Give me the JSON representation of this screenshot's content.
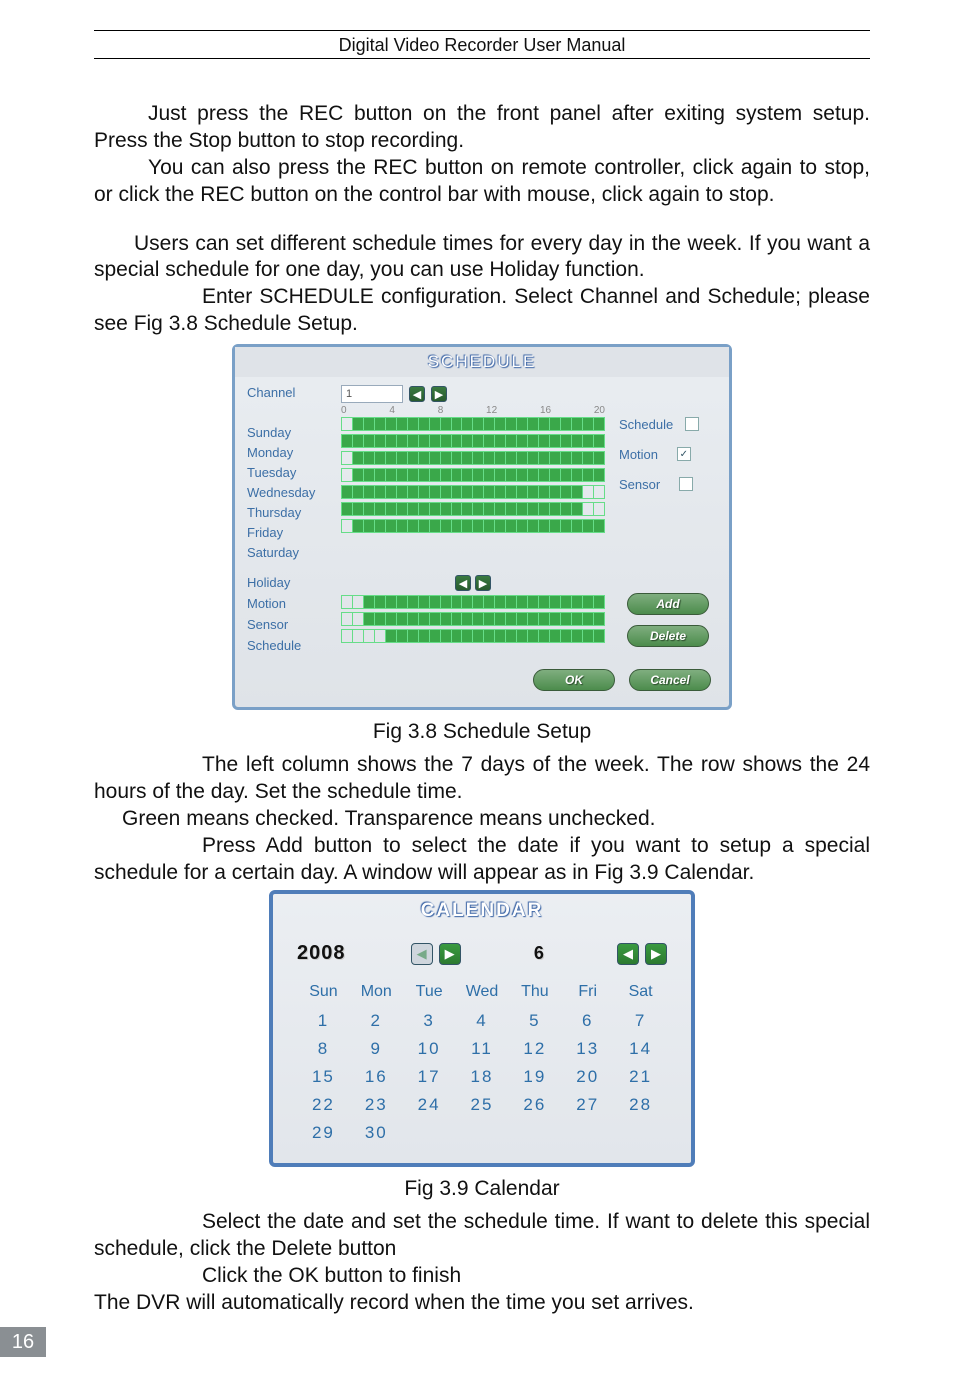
{
  "header": {
    "title": "Digital Video Recorder User Manual"
  },
  "paragraphs": {
    "p1": "Just press the REC button on the front panel after exiting system setup. Press the Stop button to stop recording.",
    "p2": "You can also press the REC button on remote controller, click again to stop, or click the REC button on the control bar with mouse, click again to stop.",
    "p3": "Users can set different schedule times for every day in the week. If you want a special schedule for one day, you can use Holiday function.",
    "p4": "Enter SCHEDULE configuration. Select Channel and Schedule; please see Fig 3.8 Schedule Setup.",
    "cap1": "Fig 3.8 Schedule Setup",
    "p5": "The left column shows the 7 days of the week. The row shows the 24 hours of the day. Set the schedule time.",
    "p6": "Green means checked. Transparence means unchecked.",
    "p7": "Press Add button to select the date if you want to setup a special schedule for a certain day. A window will appear as in Fig 3.9   Calendar.",
    "cap2": "Fig 3.9   Calendar",
    "p8": "Select the date and set the schedule time. If want to delete this special schedule, click the Delete button",
    "p9": "Click the OK button to finish",
    "p10": "The DVR will automatically record when the time you set arrives."
  },
  "page_number": "16",
  "schedule": {
    "title": "SCHEDULE",
    "channel_label": "Channel",
    "channel_value": "1",
    "hour_ticks": [
      "0",
      "4",
      "8",
      "12",
      "16",
      "20"
    ],
    "days": [
      "Sunday",
      "Monday",
      "Tuesday",
      "Wednesday",
      "Thursday",
      "Friday",
      "Saturday"
    ],
    "legends": [
      {
        "label": "Schedule",
        "checked": false
      },
      {
        "label": "Motion",
        "checked": true
      },
      {
        "label": "Sensor",
        "checked": false
      }
    ],
    "holiday": {
      "rows": [
        "Holiday",
        "Motion",
        "Sensor",
        "Schedule"
      ]
    },
    "buttons": {
      "add": "Add",
      "delete": "Delete",
      "ok": "OK",
      "cancel": "Cancel"
    }
  },
  "calendar": {
    "title": "CALENDAR",
    "year": "2008",
    "month": "6",
    "weekday_headers": [
      "Sun",
      "Mon",
      "Tue",
      "Wed",
      "Thu",
      "Fri",
      "Sat"
    ],
    "rows": [
      [
        "1",
        "2",
        "3",
        "4",
        "5",
        "6",
        "7"
      ],
      [
        "8",
        "9",
        "10",
        "11",
        "12",
        "13",
        "14"
      ],
      [
        "15",
        "16",
        "17",
        "18",
        "19",
        "20",
        "21"
      ],
      [
        "22",
        "23",
        "24",
        "25",
        "26",
        "27",
        "28"
      ],
      [
        "29",
        "30",
        "",
        "",
        "",
        "",
        ""
      ]
    ]
  }
}
